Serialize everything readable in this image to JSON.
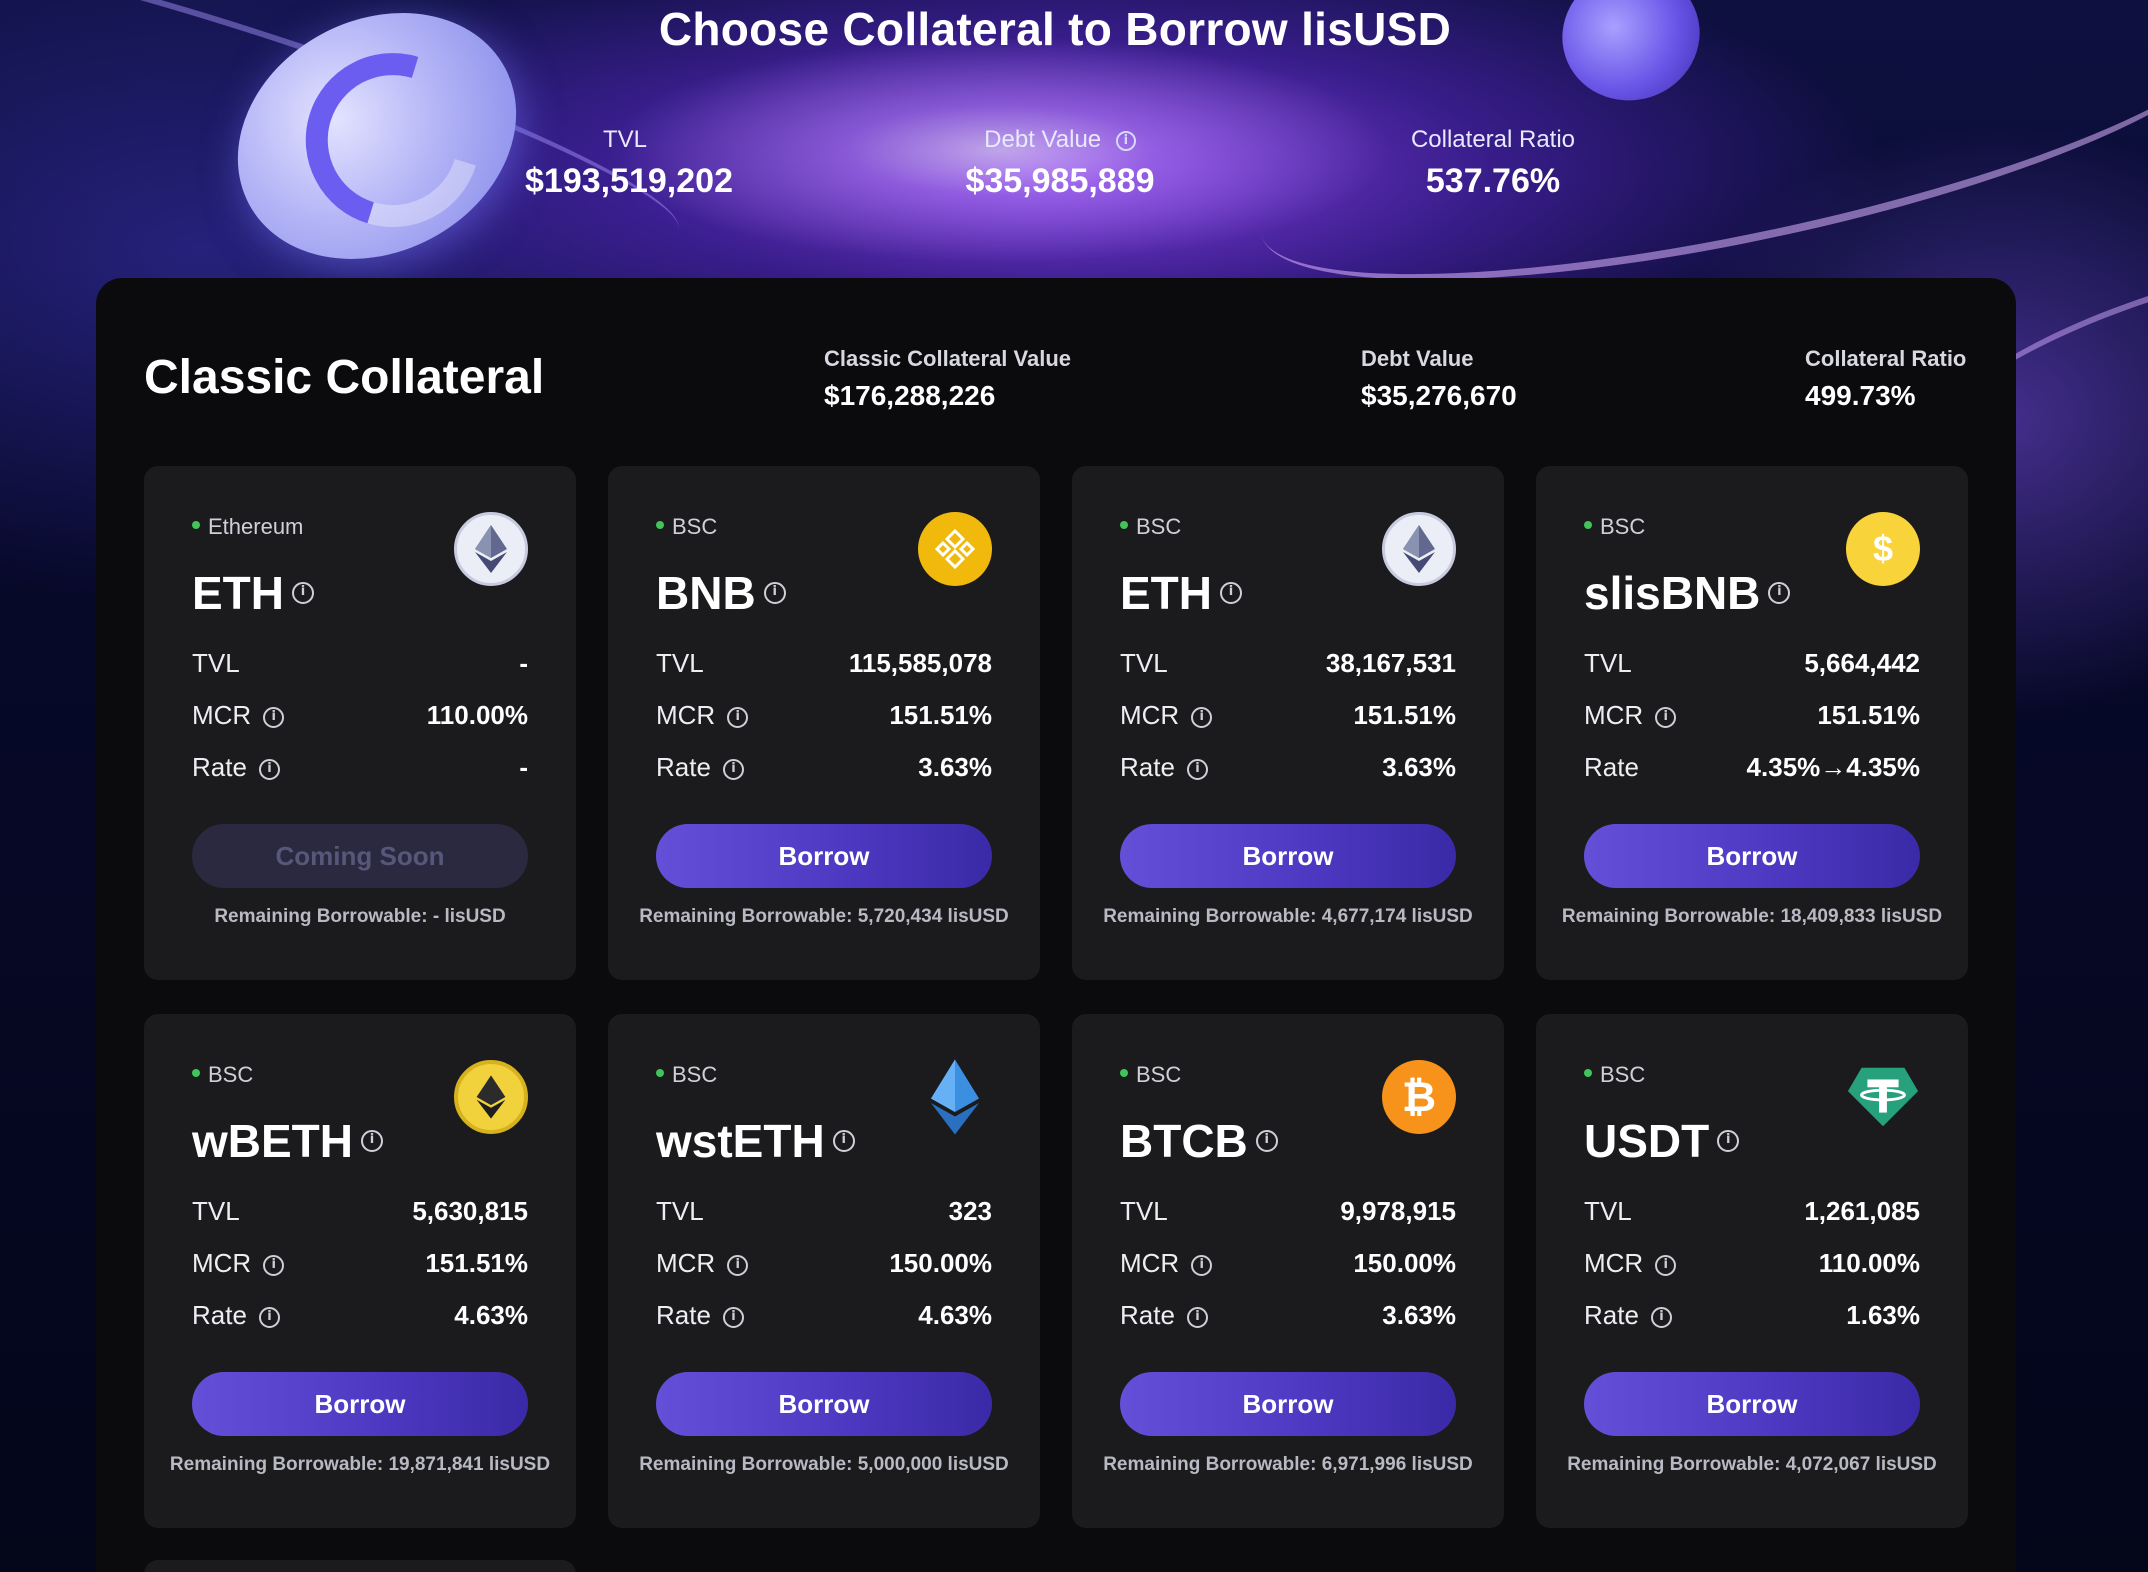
{
  "title": "Choose Collateral to Borrow lisUSD",
  "top_stats": [
    {
      "label": "TVL",
      "value": "$193,519,202",
      "info": false
    },
    {
      "label": "Debt Value",
      "value": "$35,985,889",
      "info": true
    },
    {
      "label": "Collateral Ratio",
      "value": "537.76%",
      "info": false
    }
  ],
  "panel": {
    "title": "Classic Collateral",
    "stats": [
      {
        "label": "Classic Collateral Value",
        "value": "$176,288,226"
      },
      {
        "label": "Debt Value",
        "value": "$35,276,670"
      },
      {
        "label": "Collateral Ratio",
        "value": "499.73%"
      }
    ]
  },
  "labels": {
    "tvl": "TVL",
    "mcr": "MCR",
    "rate": "Rate",
    "info_glyph": "i"
  },
  "cards": [
    {
      "chain": "Ethereum",
      "name": "ETH",
      "icon": "ethereum-icon",
      "tvl": "-",
      "mcr": "110.00%",
      "rate": "-",
      "rate_info": true,
      "button": "Coming Soon",
      "enabled": false,
      "remaining": "Remaining Borrowable: - lisUSD"
    },
    {
      "chain": "BSC",
      "name": "BNB",
      "icon": "bnb-icon",
      "tvl": "115,585,078",
      "mcr": "151.51%",
      "rate": "3.63%",
      "rate_info": true,
      "button": "Borrow",
      "enabled": true,
      "remaining": "Remaining Borrowable: 5,720,434 lisUSD"
    },
    {
      "chain": "BSC",
      "name": "ETH",
      "icon": "ethereum-icon",
      "tvl": "38,167,531",
      "mcr": "151.51%",
      "rate": "3.63%",
      "rate_info": true,
      "button": "Borrow",
      "enabled": true,
      "remaining": "Remaining Borrowable: 4,677,174 lisUSD"
    },
    {
      "chain": "BSC",
      "name": "slisBNB",
      "icon": "slisbnb-icon",
      "tvl": "5,664,442",
      "mcr": "151.51%",
      "rate": "4.35%→4.35%",
      "rate_info": false,
      "button": "Borrow",
      "enabled": true,
      "remaining": "Remaining Borrowable: 18,409,833 lisUSD"
    },
    {
      "chain": "BSC",
      "name": "wBETH",
      "icon": "wbeth-icon",
      "tvl": "5,630,815",
      "mcr": "151.51%",
      "rate": "4.63%",
      "rate_info": true,
      "button": "Borrow",
      "enabled": true,
      "remaining": "Remaining Borrowable: 19,871,841 lisUSD"
    },
    {
      "chain": "BSC",
      "name": "wstETH",
      "icon": "wsteth-icon",
      "tvl": "323",
      "mcr": "150.00%",
      "rate": "4.63%",
      "rate_info": true,
      "button": "Borrow",
      "enabled": true,
      "remaining": "Remaining Borrowable: 5,000,000 lisUSD"
    },
    {
      "chain": "BSC",
      "name": "BTCB",
      "icon": "bitcoin-icon",
      "tvl": "9,978,915",
      "mcr": "150.00%",
      "rate": "3.63%",
      "rate_info": true,
      "button": "Borrow",
      "enabled": true,
      "remaining": "Remaining Borrowable: 6,971,996 lisUSD"
    },
    {
      "chain": "BSC",
      "name": "USDT",
      "icon": "tether-icon",
      "tvl": "1,261,085",
      "mcr": "110.00%",
      "rate": "1.63%",
      "rate_info": true,
      "button": "Borrow",
      "enabled": true,
      "remaining": "Remaining Borrowable: 4,072,067 lisUSD"
    }
  ],
  "icon_glyphs": {
    "bitcoin-icon": "₿",
    "tether-icon": "₮",
    "slisbnb-icon": "$"
  },
  "colors": {
    "accent": "#5a45d0",
    "chain_dot": "#3fc55a",
    "bnb": "#f0b90b",
    "bitcoin": "#f7931a",
    "tether": "#26a17b",
    "slisbnb": "#f8d33a"
  }
}
